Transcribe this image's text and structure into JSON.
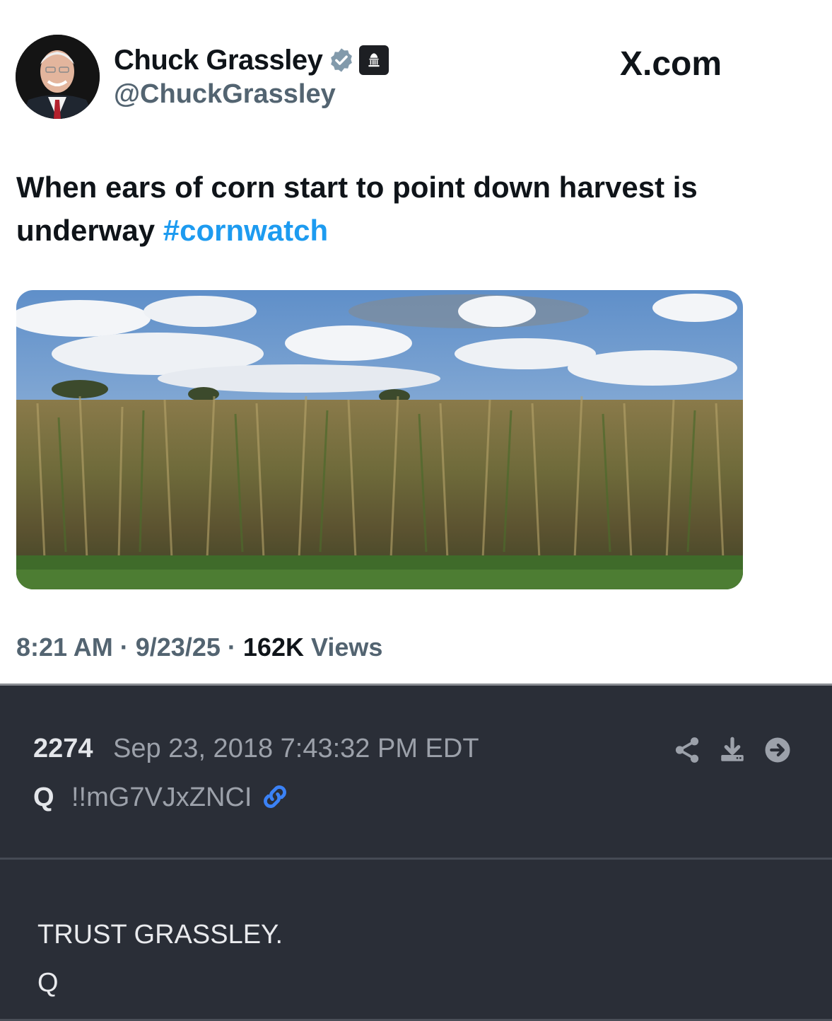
{
  "tweet": {
    "display_name": "Chuck Grassley",
    "handle": "@ChuckGrassley",
    "brand": "X.com",
    "text": "When ears of corn start to point down harvest is underway",
    "hashtag": "#cornwatch",
    "time": "8:21 AM",
    "date": "9/23/25",
    "views_count": "162K",
    "views_label": "Views",
    "separator": "·",
    "icons": [
      "verified-badge-icon",
      "government-building-icon"
    ],
    "colors": {
      "hashtag": "#1d9bf0",
      "text": "#0f1419",
      "muted": "#536471"
    }
  },
  "post": {
    "number": "2274",
    "timestamp": "Sep 23, 2018 7:43:32 PM EDT",
    "author": "Q",
    "tripcode": "!!mG7VJxZNCI",
    "body_line1": "TRUST GRASSLEY.",
    "body_line2": "Q",
    "icons": [
      "link-icon",
      "share-icon",
      "download-icon",
      "arrow-right-circle-icon"
    ],
    "colors": {
      "background": "#2a2e37",
      "link": "#3b82f6"
    }
  }
}
